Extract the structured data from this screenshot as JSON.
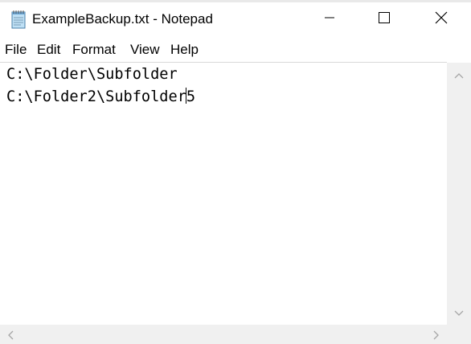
{
  "window": {
    "title": "ExampleBackup.txt - Notepad",
    "icon": "notepad-icon",
    "controls": {
      "minimize_icon": "minimize-icon",
      "maximize_icon": "maximize-icon",
      "close_icon": "close-icon"
    }
  },
  "menubar": {
    "items": [
      {
        "label": "File"
      },
      {
        "label": "Edit"
      },
      {
        "label": "Format"
      },
      {
        "label": "View"
      },
      {
        "label": "Help"
      }
    ]
  },
  "editor": {
    "lines": [
      {
        "text": "C:\\Folder\\Subfolder"
      },
      {
        "text_before_caret": "C:\\Folder2\\Subfolder",
        "text_after_caret": "5"
      }
    ]
  },
  "colors": {
    "background": "#ffffff",
    "scrollbar_track": "#f0f0f0",
    "scrollbar_arrow": "#a6a6a6"
  }
}
